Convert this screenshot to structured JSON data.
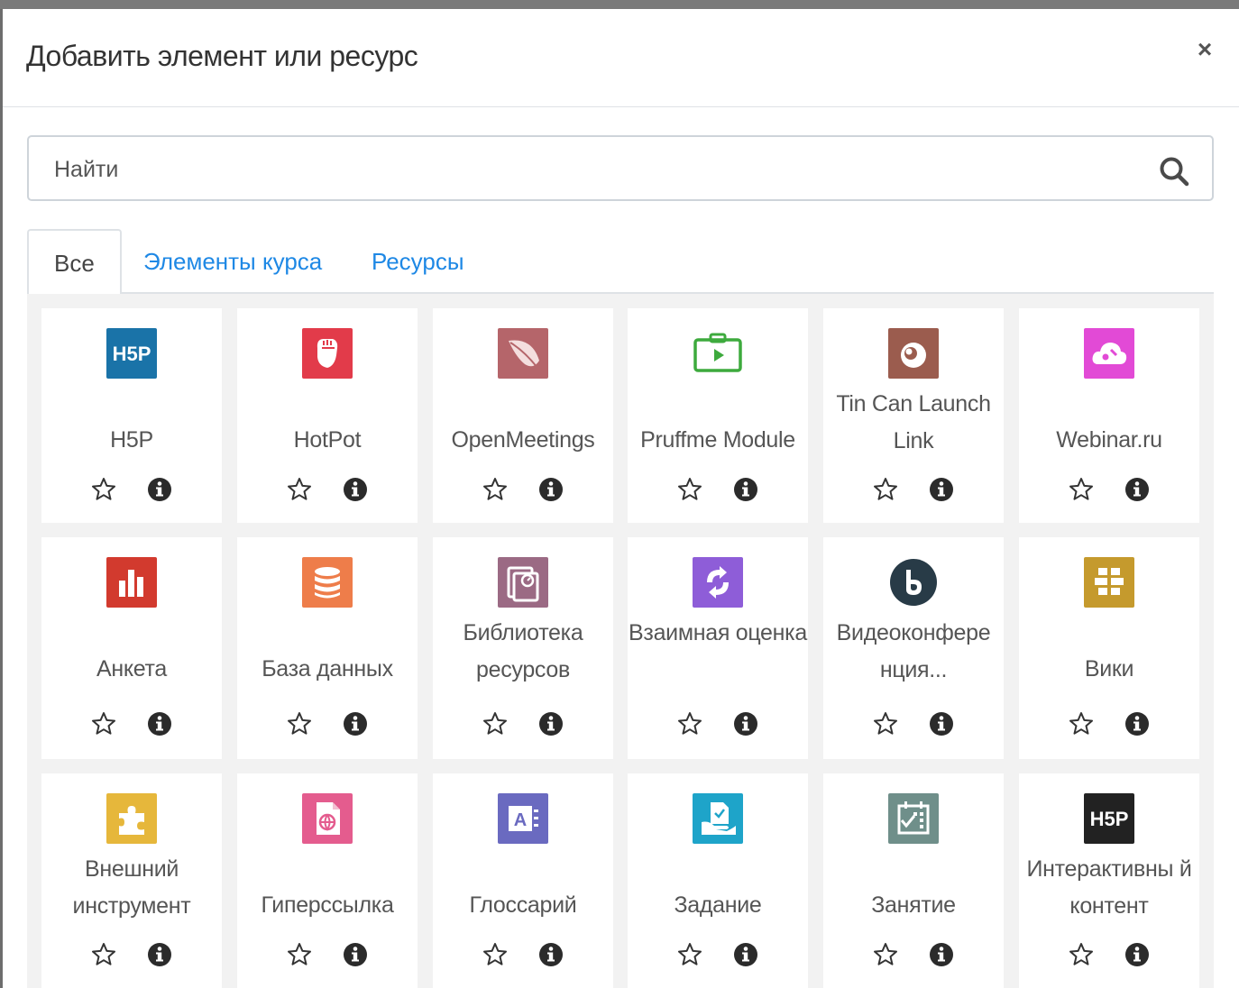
{
  "modal": {
    "title": "Добавить элемент или ресурс",
    "close_label": "×"
  },
  "search": {
    "placeholder": "Найти"
  },
  "tabs": [
    {
      "label": "Все",
      "active": true
    },
    {
      "label": "Элементы курса",
      "active": false
    },
    {
      "label": "Ресурсы",
      "active": false
    }
  ],
  "items": [
    {
      "name": "H5P",
      "icon": "h5p-icon",
      "color": "#1a73a8"
    },
    {
      "name": "HotPot",
      "icon": "hotpot-icon",
      "color": "#e23b4a"
    },
    {
      "name": "OpenMeetings",
      "icon": "openmeetings-feather-icon",
      "color": "#b5656a"
    },
    {
      "name": "Pruffme Module",
      "icon": "pruffme-video-icon",
      "color": "#3daa3d"
    },
    {
      "name": "Tin Can Launch Link",
      "icon": "tincan-icon",
      "color": "#9b5c4e"
    },
    {
      "name": "Webinar.ru",
      "icon": "webinar-cloud-icon",
      "color": "#e24ad6"
    },
    {
      "name": "Анкета",
      "icon": "bar-chart-icon",
      "color": "#d23a2e"
    },
    {
      "name": "База данных",
      "icon": "database-icon",
      "color": "#ee7d4a"
    },
    {
      "name": "Библиотека ресурсов",
      "icon": "library-icon",
      "color": "#9b6a84"
    },
    {
      "name": "Взаимная оценка",
      "icon": "peer-review-icon",
      "color": "#8e5dd8"
    },
    {
      "name": "Видеоконфере нция...",
      "icon": "bigbluebutton-icon",
      "color": "#283b47"
    },
    {
      "name": "Вики",
      "icon": "wiki-icon",
      "color": "#c59a2d"
    },
    {
      "name": "Внешний инструмент",
      "icon": "puzzle-icon",
      "color": "#e6b73b"
    },
    {
      "name": "Гиперссылка",
      "icon": "url-globe-icon",
      "color": "#e45c8e"
    },
    {
      "name": "Глоссарий",
      "icon": "glossary-icon",
      "color": "#6a6ac0"
    },
    {
      "name": "Задание",
      "icon": "assignment-icon",
      "color": "#1ea4c9"
    },
    {
      "name": "Занятие",
      "icon": "lesson-calendar-icon",
      "color": "#6f8f8a"
    },
    {
      "name": "Интерактивны й контент",
      "icon": "h5p-dark-icon",
      "color": "#222222"
    }
  ]
}
